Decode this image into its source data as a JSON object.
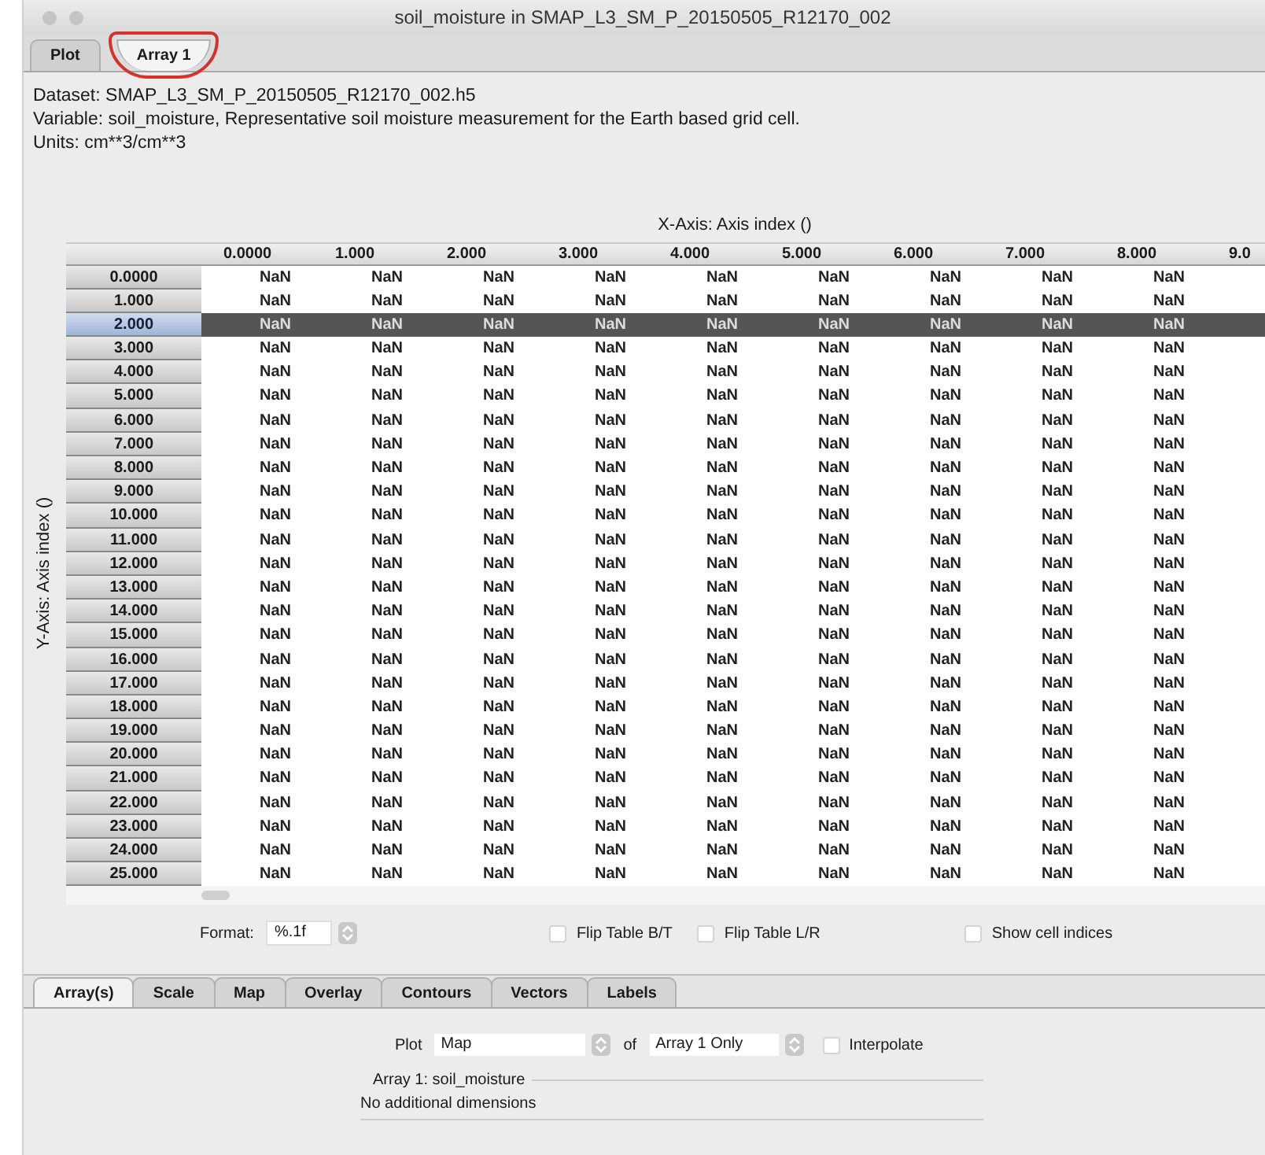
{
  "window": {
    "title": "soil_moisture in SMAP_L3_SM_P_20150505_R12170_002"
  },
  "tabs": [
    {
      "label": "Plot",
      "selected": false,
      "circled": false
    },
    {
      "label": "Array 1",
      "selected": true,
      "circled": true
    }
  ],
  "info": [
    "Dataset: SMAP_L3_SM_P_20150505_R12170_002.h5",
    "Variable: soil_moisture, Representative soil moisture measurement for the Earth based grid cell.",
    "Units: cm**3/cm**3"
  ],
  "table": {
    "x_axis_title": "X-Axis: Axis index ()",
    "y_axis_title": "Y-Axis: Axis index ()",
    "columns": [
      "0.0000",
      "1.000",
      "2.000",
      "3.000",
      "4.000",
      "5.000",
      "6.000",
      "7.000",
      "8.000",
      "9.0"
    ],
    "rows": [
      {
        "label": "0.0000",
        "selected": false,
        "cells": [
          "NaN",
          "NaN",
          "NaN",
          "NaN",
          "NaN",
          "NaN",
          "NaN",
          "NaN",
          "NaN"
        ]
      },
      {
        "label": "1.000",
        "selected": false,
        "cells": [
          "NaN",
          "NaN",
          "NaN",
          "NaN",
          "NaN",
          "NaN",
          "NaN",
          "NaN",
          "NaN"
        ]
      },
      {
        "label": "2.000",
        "selected": true,
        "cells": [
          "NaN",
          "NaN",
          "NaN",
          "NaN",
          "NaN",
          "NaN",
          "NaN",
          "NaN",
          "NaN"
        ]
      },
      {
        "label": "3.000",
        "selected": false,
        "cells": [
          "NaN",
          "NaN",
          "NaN",
          "NaN",
          "NaN",
          "NaN",
          "NaN",
          "NaN",
          "NaN"
        ]
      },
      {
        "label": "4.000",
        "selected": false,
        "cells": [
          "NaN",
          "NaN",
          "NaN",
          "NaN",
          "NaN",
          "NaN",
          "NaN",
          "NaN",
          "NaN"
        ]
      },
      {
        "label": "5.000",
        "selected": false,
        "cells": [
          "NaN",
          "NaN",
          "NaN",
          "NaN",
          "NaN",
          "NaN",
          "NaN",
          "NaN",
          "NaN"
        ]
      },
      {
        "label": "6.000",
        "selected": false,
        "cells": [
          "NaN",
          "NaN",
          "NaN",
          "NaN",
          "NaN",
          "NaN",
          "NaN",
          "NaN",
          "NaN"
        ]
      },
      {
        "label": "7.000",
        "selected": false,
        "cells": [
          "NaN",
          "NaN",
          "NaN",
          "NaN",
          "NaN",
          "NaN",
          "NaN",
          "NaN",
          "NaN"
        ]
      },
      {
        "label": "8.000",
        "selected": false,
        "cells": [
          "NaN",
          "NaN",
          "NaN",
          "NaN",
          "NaN",
          "NaN",
          "NaN",
          "NaN",
          "NaN"
        ]
      },
      {
        "label": "9.000",
        "selected": false,
        "cells": [
          "NaN",
          "NaN",
          "NaN",
          "NaN",
          "NaN",
          "NaN",
          "NaN",
          "NaN",
          "NaN"
        ]
      },
      {
        "label": "10.000",
        "selected": false,
        "cells": [
          "NaN",
          "NaN",
          "NaN",
          "NaN",
          "NaN",
          "NaN",
          "NaN",
          "NaN",
          "NaN"
        ]
      },
      {
        "label": "11.000",
        "selected": false,
        "cells": [
          "NaN",
          "NaN",
          "NaN",
          "NaN",
          "NaN",
          "NaN",
          "NaN",
          "NaN",
          "NaN"
        ]
      },
      {
        "label": "12.000",
        "selected": false,
        "cells": [
          "NaN",
          "NaN",
          "NaN",
          "NaN",
          "NaN",
          "NaN",
          "NaN",
          "NaN",
          "NaN"
        ]
      },
      {
        "label": "13.000",
        "selected": false,
        "cells": [
          "NaN",
          "NaN",
          "NaN",
          "NaN",
          "NaN",
          "NaN",
          "NaN",
          "NaN",
          "NaN"
        ]
      },
      {
        "label": "14.000",
        "selected": false,
        "cells": [
          "NaN",
          "NaN",
          "NaN",
          "NaN",
          "NaN",
          "NaN",
          "NaN",
          "NaN",
          "NaN"
        ]
      },
      {
        "label": "15.000",
        "selected": false,
        "cells": [
          "NaN",
          "NaN",
          "NaN",
          "NaN",
          "NaN",
          "NaN",
          "NaN",
          "NaN",
          "NaN"
        ]
      },
      {
        "label": "16.000",
        "selected": false,
        "cells": [
          "NaN",
          "NaN",
          "NaN",
          "NaN",
          "NaN",
          "NaN",
          "NaN",
          "NaN",
          "NaN"
        ]
      },
      {
        "label": "17.000",
        "selected": false,
        "cells": [
          "NaN",
          "NaN",
          "NaN",
          "NaN",
          "NaN",
          "NaN",
          "NaN",
          "NaN",
          "NaN"
        ]
      },
      {
        "label": "18.000",
        "selected": false,
        "cells": [
          "NaN",
          "NaN",
          "NaN",
          "NaN",
          "NaN",
          "NaN",
          "NaN",
          "NaN",
          "NaN"
        ]
      },
      {
        "label": "19.000",
        "selected": false,
        "cells": [
          "NaN",
          "NaN",
          "NaN",
          "NaN",
          "NaN",
          "NaN",
          "NaN",
          "NaN",
          "NaN"
        ]
      },
      {
        "label": "20.000",
        "selected": false,
        "cells": [
          "NaN",
          "NaN",
          "NaN",
          "NaN",
          "NaN",
          "NaN",
          "NaN",
          "NaN",
          "NaN"
        ]
      },
      {
        "label": "21.000",
        "selected": false,
        "cells": [
          "NaN",
          "NaN",
          "NaN",
          "NaN",
          "NaN",
          "NaN",
          "NaN",
          "NaN",
          "NaN"
        ]
      },
      {
        "label": "22.000",
        "selected": false,
        "cells": [
          "NaN",
          "NaN",
          "NaN",
          "NaN",
          "NaN",
          "NaN",
          "NaN",
          "NaN",
          "NaN"
        ]
      },
      {
        "label": "23.000",
        "selected": false,
        "cells": [
          "NaN",
          "NaN",
          "NaN",
          "NaN",
          "NaN",
          "NaN",
          "NaN",
          "NaN",
          "NaN"
        ]
      },
      {
        "label": "24.000",
        "selected": false,
        "cells": [
          "NaN",
          "NaN",
          "NaN",
          "NaN",
          "NaN",
          "NaN",
          "NaN",
          "NaN",
          "NaN"
        ]
      },
      {
        "label": "25.000",
        "selected": false,
        "cells": [
          "NaN",
          "NaN",
          "NaN",
          "NaN",
          "NaN",
          "NaN",
          "NaN",
          "NaN",
          "NaN"
        ]
      }
    ]
  },
  "format": {
    "label": "Format:",
    "value": "%.1f"
  },
  "options": [
    {
      "label": "Flip Table B/T",
      "checked": false
    },
    {
      "label": "Flip Table L/R",
      "checked": false
    },
    {
      "label": "Show cell indices",
      "checked": false
    }
  ],
  "bottom_tabs": [
    {
      "label": "Array(s)",
      "selected": true
    },
    {
      "label": "Scale",
      "selected": false
    },
    {
      "label": "Map",
      "selected": false
    },
    {
      "label": "Overlay",
      "selected": false
    },
    {
      "label": "Contours",
      "selected": false
    },
    {
      "label": "Vectors",
      "selected": false
    },
    {
      "label": "Labels",
      "selected": false
    }
  ],
  "plot": {
    "label": "Plot",
    "type": "Map",
    "of_label": "of",
    "arrays": "Array 1 Only",
    "interpolate": {
      "label": "Interpolate",
      "checked": false
    }
  },
  "array_group": {
    "title": "Array 1: soil_moisture",
    "text": "No additional dimensions"
  }
}
